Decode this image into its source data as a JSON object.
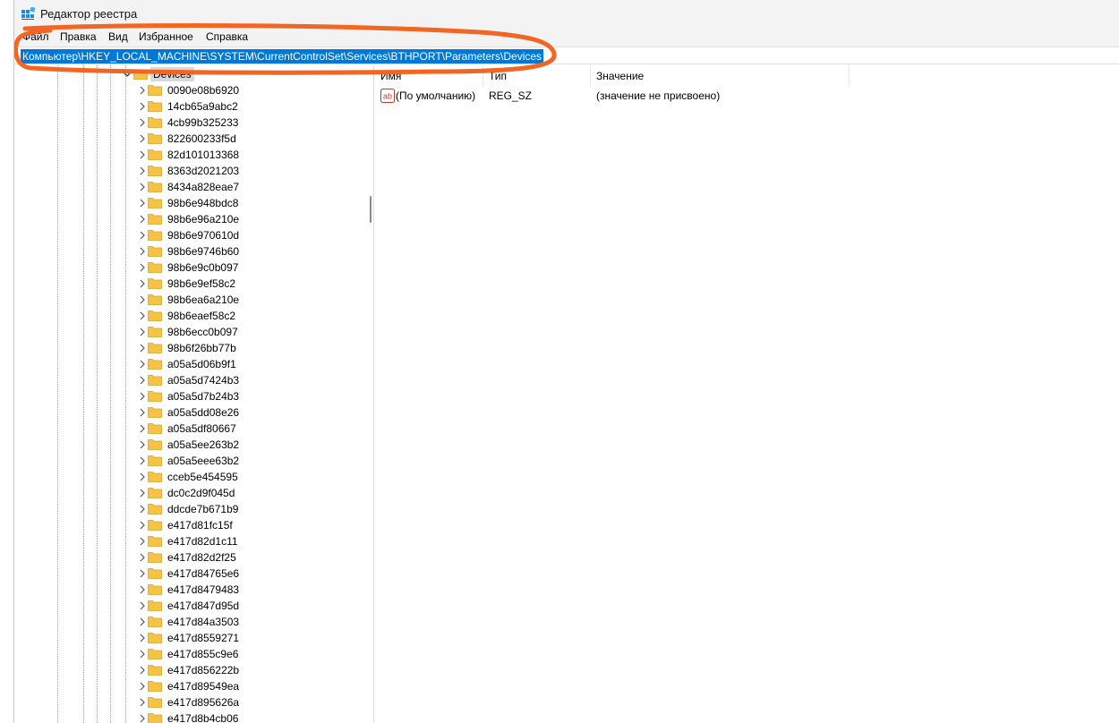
{
  "window": {
    "title": "Редактор реестра",
    "icon": "registry-editor-icon"
  },
  "menu": [
    "Файл",
    "Правка",
    "Вид",
    "Избранное",
    "Справка"
  ],
  "address": {
    "path": "Компьютер\\HKEY_LOCAL_MACHINE\\SYSTEM\\CurrentControlSet\\Services\\BTHPORT\\Parameters\\Devices"
  },
  "tree": {
    "selected": "Devices",
    "children": [
      "0090e08b6920",
      "14cb65a9abc2",
      "4cb99b325233",
      "822600233f5d",
      "82d101013368",
      "8363d2021203",
      "8434a828eae7",
      "98b6e948bdc8",
      "98b6e96a210e",
      "98b6e970610d",
      "98b6e9746b60",
      "98b6e9c0b097",
      "98b6e9ef58c2",
      "98b6ea6a210e",
      "98b6eaef58c2",
      "98b6ecc0b097",
      "98b6f26bb77b",
      "a05a5d06b9f1",
      "a05a5d7424b3",
      "a05a5d7b24b3",
      "a05a5dd08e26",
      "a05a5df80667",
      "a05a5ee263b2",
      "a05a5eee63b2",
      "cceb5e454595",
      "dc0c2d9f045d",
      "ddcde7b671b9",
      "e417d81fc15f",
      "e417d82d1c11",
      "e417d82d2f25",
      "e417d84765e6",
      "e417d8479483",
      "e417d847d95d",
      "e417d84a3503",
      "e417d8559271",
      "e417d855c9e6",
      "e417d856222b",
      "e417d89549ea",
      "e417d895626a",
      "e417d8b4cb06"
    ]
  },
  "values": {
    "headers": {
      "name": "Имя",
      "type": "Тип",
      "value": "Значение"
    },
    "rows": [
      {
        "name": "(По умолчанию)",
        "type": "REG_SZ",
        "value": "(значение не присвоено)",
        "icon": "string-value-icon"
      }
    ]
  },
  "colors": {
    "selection": "#0078d7",
    "annotation": "#f26522",
    "folder": "#f6c344"
  }
}
